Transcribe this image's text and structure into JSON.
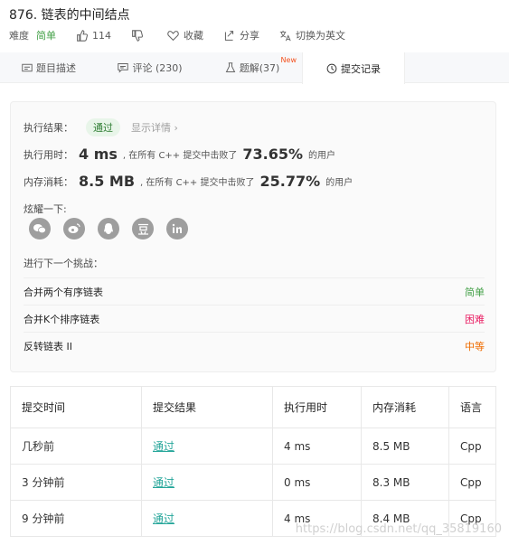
{
  "problem": {
    "title": "876. 链表的中间结点",
    "difficulty_label": "难度",
    "difficulty": "简单",
    "likes": "114",
    "favorite": "收藏",
    "share": "分享",
    "switch_lang": "切换为英文"
  },
  "tabs": [
    {
      "label": "题目描述",
      "icon": "document-icon"
    },
    {
      "label": "评论 (230)",
      "icon": "comment-icon"
    },
    {
      "label": "题解(37)",
      "icon": "flask-icon",
      "badge": "New"
    },
    {
      "label": "提交记录",
      "icon": "clock-icon"
    }
  ],
  "result": {
    "label": "执行结果：",
    "status": "通过",
    "details": "显示详情 ›",
    "time_label": "执行用时：",
    "time": "4 ms",
    "time_text": ", 在所有 C++ 提交中击败了",
    "time_pct": "73.65%",
    "time_suffix": "的用户",
    "mem_label": "内存消耗：",
    "mem": "8.5 MB",
    "mem_text": ", 在所有 C++ 提交中击败了",
    "mem_pct": "25.77%",
    "mem_suffix": "的用户",
    "share_label": "炫耀一下:",
    "share_icons": [
      "wechat-icon",
      "weibo-icon",
      "qq-icon",
      "douban-icon",
      "linkedin-icon"
    ],
    "next_label": "进行下一个挑战：",
    "challenges": [
      {
        "title": "合并两个有序链表",
        "level": "简单",
        "color": "#43a047"
      },
      {
        "title": "合并K个排序链表",
        "level": "困难",
        "color": "#e91e63"
      },
      {
        "title": "反转链表 II",
        "level": "中等",
        "color": "#ef6c00"
      }
    ]
  },
  "submissions": {
    "headers": [
      "提交时间",
      "提交结果",
      "执行用时",
      "内存消耗",
      "语言"
    ],
    "rows": [
      [
        "几秒前",
        "通过",
        "4 ms",
        "8.5 MB",
        "Cpp"
      ],
      [
        "3 分钟前",
        "通过",
        "0 ms",
        "8.3 MB",
        "Cpp"
      ],
      [
        "9 分钟前",
        "通过",
        "4 ms",
        "8.4 MB",
        "Cpp"
      ]
    ]
  },
  "watermark": "https://blog.csdn.net/qq_35819160"
}
